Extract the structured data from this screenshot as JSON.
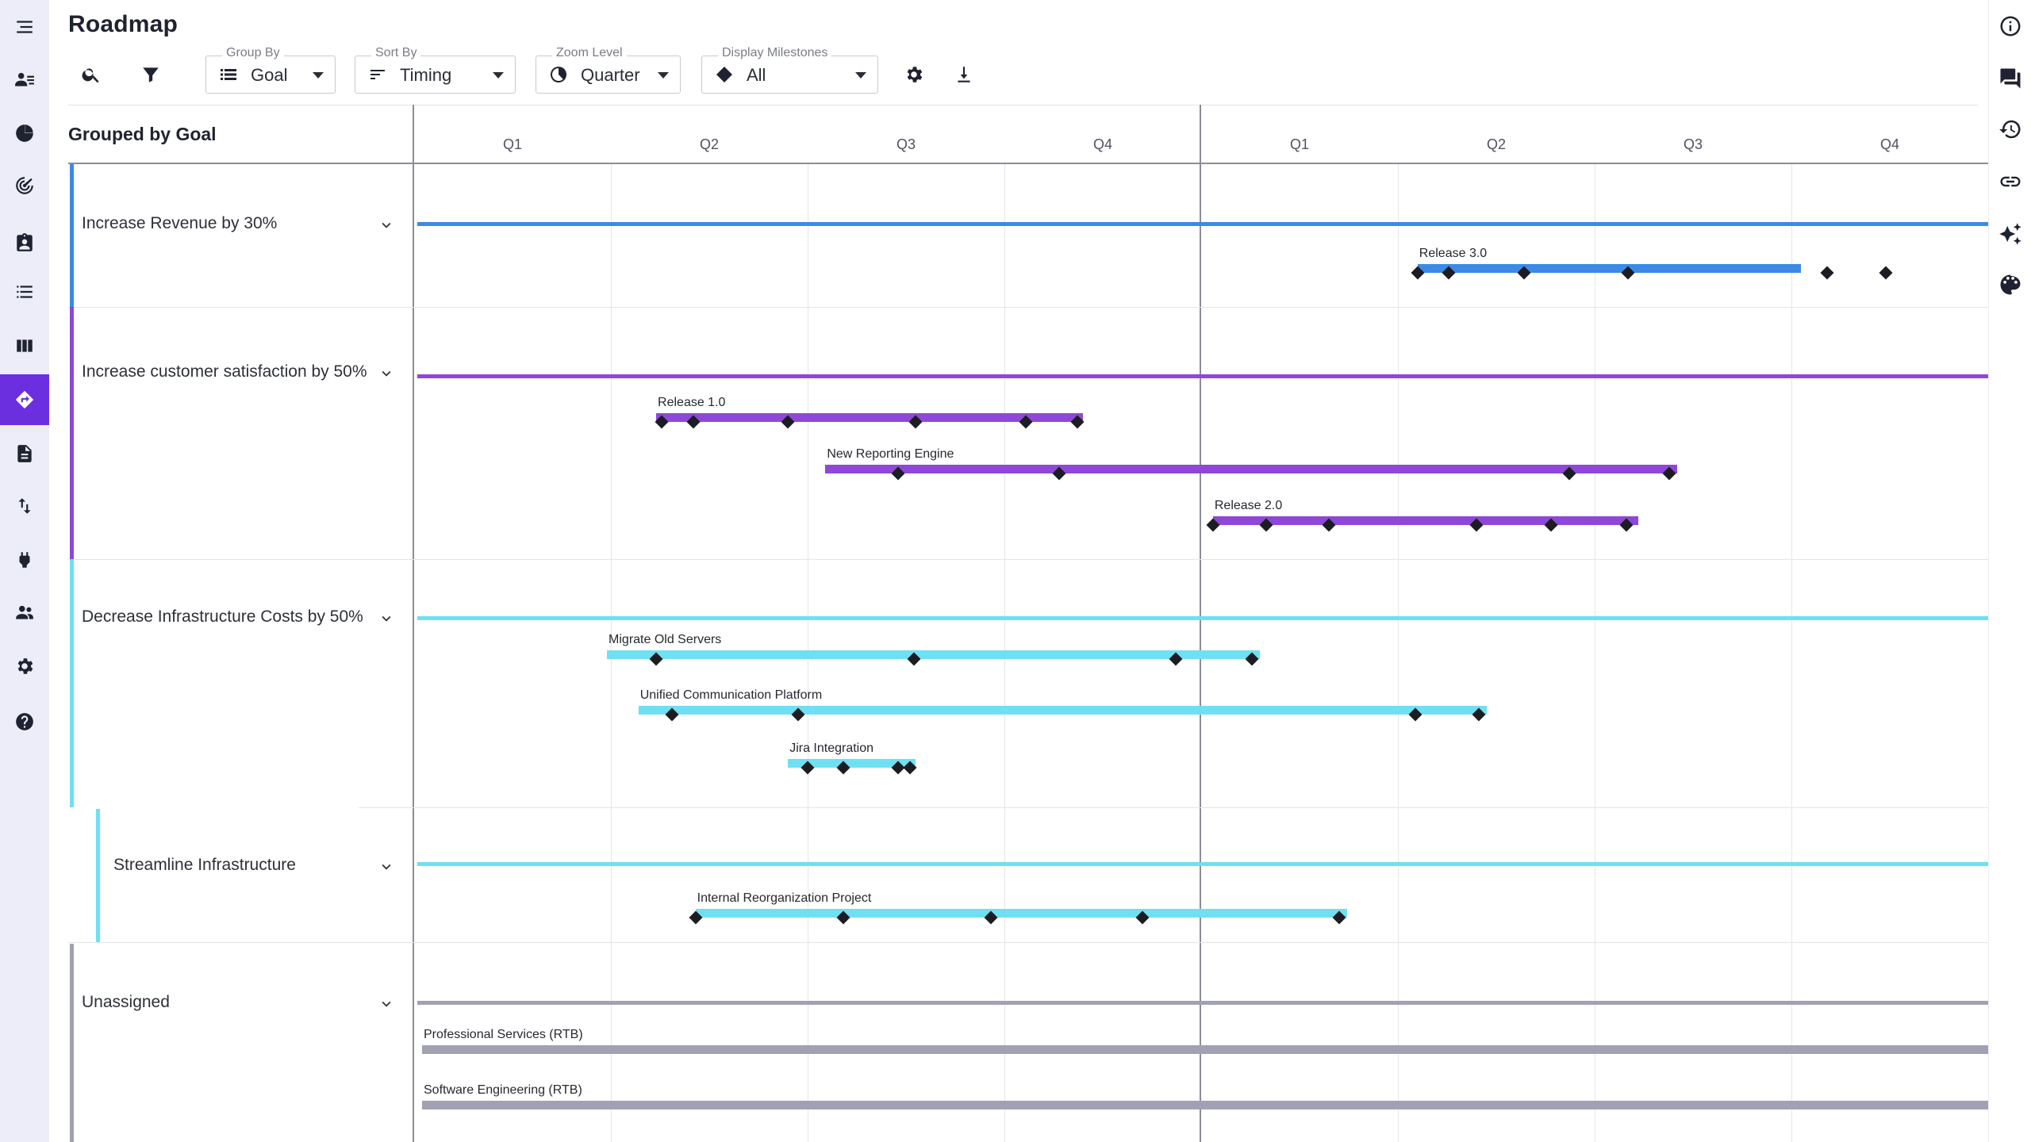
{
  "page": {
    "title": "Roadmap"
  },
  "nav": {
    "items": [
      {
        "icon": "menu-collapse-icon"
      },
      {
        "icon": "persona-icon"
      },
      {
        "icon": "strategy-icon"
      },
      {
        "icon": "goal-target-icon"
      },
      {
        "icon": "clipboard-icon"
      },
      {
        "icon": "list-icon"
      },
      {
        "icon": "board-columns-icon"
      },
      {
        "icon": "roadmap-icon",
        "active": true
      },
      {
        "icon": "document-icon"
      },
      {
        "icon": "sync-arrows-icon"
      },
      {
        "icon": "plug-icon"
      },
      {
        "icon": "people-icon"
      },
      {
        "icon": "gear-icon"
      },
      {
        "icon": "help-icon"
      }
    ]
  },
  "rail": {
    "items": [
      {
        "icon": "info-icon"
      },
      {
        "icon": "comments-icon"
      },
      {
        "icon": "history-icon"
      },
      {
        "icon": "link-icon"
      },
      {
        "icon": "ai-sparkle-icon"
      },
      {
        "icon": "palette-icon"
      }
    ]
  },
  "toolbar": {
    "search_icon": "search-icon",
    "filter_icon": "filter-icon",
    "group_by": {
      "label": "Group By",
      "value": "Goal",
      "icon": "group-list-icon"
    },
    "sort_by": {
      "label": "Sort By",
      "value": "Timing",
      "icon": "sort-icon"
    },
    "zoom_level": {
      "label": "Zoom Level",
      "value": "Quarter",
      "icon": "zoom-circle-icon"
    },
    "display_milestones": {
      "label": "Display Milestones",
      "value": "All",
      "icon": "diamond-icon"
    },
    "settings_icon": "gear-icon",
    "download_icon": "download-icon"
  },
  "timeline": {
    "grouped_title": "Grouped by Goal",
    "quarters": [
      "Q1",
      "Q2",
      "Q3",
      "Q4",
      "Q1",
      "Q2",
      "Q3",
      "Q4"
    ]
  },
  "groups": [
    {
      "name": "Increase Revenue by 30%",
      "color": "#3b8ae6",
      "items": [
        {
          "name": "Release 3.0",
          "start_quarter": 5.1,
          "end_quarter": 7.05,
          "milestones": [
            5.1,
            5.26,
            5.64,
            6.17,
            7.18,
            7.48
          ]
        }
      ]
    },
    {
      "name": "Increase customer satisfaction by 50%",
      "color": "#8f47d8",
      "items": [
        {
          "name": "Release 1.0",
          "start_quarter": 1.23,
          "end_quarter": 3.4,
          "milestones": [
            1.26,
            1.42,
            1.9,
            2.55,
            3.11,
            3.37
          ]
        },
        {
          "name": "New Reporting Engine",
          "start_quarter": 2.09,
          "end_quarter": 6.42,
          "milestones": [
            2.46,
            3.28,
            5.87,
            6.38
          ]
        },
        {
          "name": "Release 2.0",
          "start_quarter": 4.06,
          "end_quarter": 6.22,
          "milestones": [
            4.06,
            4.33,
            4.65,
            5.4,
            5.78,
            6.16
          ]
        }
      ]
    },
    {
      "name": "Decrease Infrastructure Costs by 50%",
      "color": "#6fe0f2",
      "items": [
        {
          "name": "Migrate Old Servers",
          "start_quarter": 0.98,
          "end_quarter": 4.3,
          "milestones": [
            1.23,
            2.54,
            3.87,
            4.26
          ]
        },
        {
          "name": "Unified Communication Platform",
          "start_quarter": 1.14,
          "end_quarter": 5.45,
          "milestones": [
            1.31,
            1.95,
            5.09,
            5.41
          ]
        },
        {
          "name": "Jira Integration",
          "start_quarter": 1.9,
          "end_quarter": 2.55,
          "milestones": [
            2.0,
            2.18,
            2.46,
            2.52
          ]
        }
      ]
    },
    {
      "name": "Streamline Infrastructure",
      "color": "#6fe0f2",
      "items": [
        {
          "name": "Internal Reorganization Project",
          "start_quarter": 1.43,
          "end_quarter": 4.74,
          "milestones": [
            1.43,
            2.18,
            2.93,
            3.7,
            4.7
          ]
        }
      ]
    },
    {
      "name": "Unassigned",
      "color": "#a1a1b3",
      "items": [
        {
          "name": "Professional Services (RTB)",
          "start_quarter": 0.04,
          "end_quarter": 8.0,
          "milestones": []
        },
        {
          "name": "Software Engineering (RTB)",
          "start_quarter": 0.04,
          "end_quarter": 8.0,
          "milestones": []
        }
      ]
    }
  ]
}
